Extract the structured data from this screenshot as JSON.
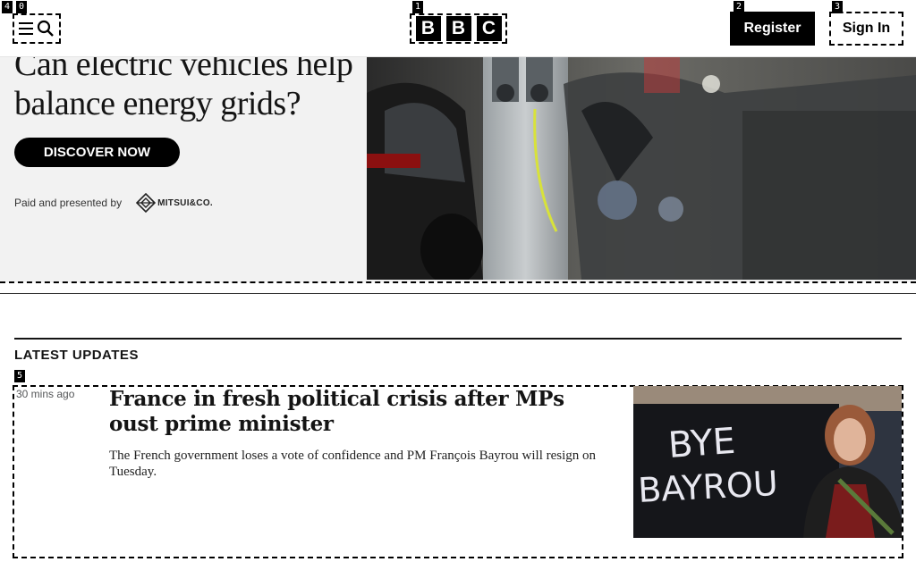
{
  "header": {
    "menu_search_icon": "menu-search-icon",
    "logo_letters": [
      "B",
      "B",
      "C"
    ],
    "register_label": "Register",
    "signin_label": "Sign In"
  },
  "promo": {
    "title": "Can electric vehicles help balance energy grids?",
    "cta_label": "DISCOVER NOW",
    "sponsor_text": "Paid and presented by",
    "sponsor_logo_text": "MITSUI&CO."
  },
  "latest": {
    "heading": "LATEST UPDATES",
    "story": {
      "time": "30 mins ago",
      "headline": "France in fresh political crisis after MPs oust prime minister",
      "summary": "The French government loses a vote of confidence and PM François Bayrou will resign on Tuesday.",
      "image_sign_line1": "BYE",
      "image_sign_line2": "BAYROU"
    }
  },
  "som_labels": [
    "4",
    "0",
    "1",
    "2",
    "3",
    "5"
  ],
  "colors": {
    "black": "#000000",
    "promo_bg": "#f2f2f2",
    "text": "#141414"
  }
}
